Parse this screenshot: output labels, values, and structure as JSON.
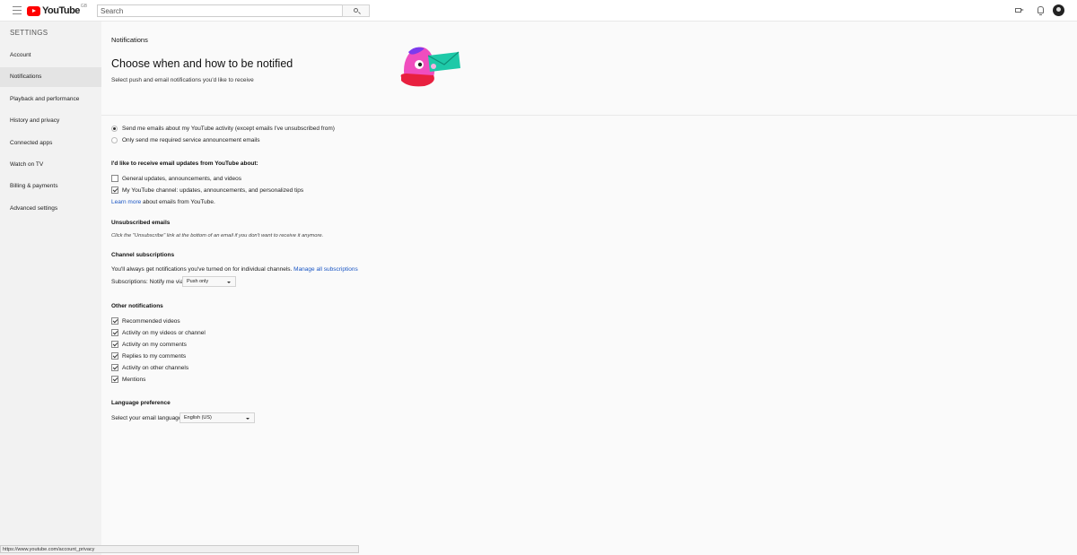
{
  "topbar": {
    "logo_text": "YouTube",
    "logo_region": "GB",
    "search_placeholder": "Search"
  },
  "sidebar": {
    "title": "SETTINGS",
    "items": [
      {
        "label": "Account"
      },
      {
        "label": "Notifications"
      },
      {
        "label": "Playback and performance"
      },
      {
        "label": "History and privacy"
      },
      {
        "label": "Connected apps"
      },
      {
        "label": "Watch on TV"
      },
      {
        "label": "Billing & payments"
      },
      {
        "label": "Advanced settings"
      }
    ]
  },
  "header": {
    "page_title": "Notifications",
    "headline": "Choose when and how to be notified",
    "subline": "Select push and email notifications you'd like to receive"
  },
  "email_mode": {
    "options": [
      {
        "label": "Send me emails about my YouTube activity (except emails I've unsubscribed from)",
        "selected": true
      },
      {
        "label": "Only send me required service announcement emails",
        "selected": false
      }
    ]
  },
  "email_updates": {
    "heading": "I'd like to receive email updates from YouTube about:",
    "options": [
      {
        "label": "General updates, announcements, and videos",
        "checked": false
      },
      {
        "label": "My YouTube channel: updates, announcements, and personalized tips",
        "checked": true
      }
    ],
    "learn_more_link": "Learn more",
    "learn_more_rest": " about emails from YouTube."
  },
  "unsubscribed": {
    "heading": "Unsubscribed emails",
    "note": "Click the \"Unsubscribe\" link at the bottom of an email if you don't want to receive it anymore."
  },
  "channel_subs": {
    "heading": "Channel subscriptions",
    "text": "You'll always get notifications you've turned on for individual channels.",
    "manage_link": "Manage all subscriptions",
    "notify_label": "Subscriptions: Notify me via",
    "notify_value": "Push only"
  },
  "other": {
    "heading": "Other notifications",
    "options": [
      {
        "label": "Recommended videos",
        "checked": true
      },
      {
        "label": "Activity on my videos or channel",
        "checked": true
      },
      {
        "label": "Activity on my comments",
        "checked": true
      },
      {
        "label": "Replies to my comments",
        "checked": true
      },
      {
        "label": "Activity on other channels",
        "checked": true
      },
      {
        "label": "Mentions",
        "checked": true
      }
    ]
  },
  "language": {
    "heading": "Language preference",
    "label": "Select your email language",
    "value": "English (US)"
  },
  "statusbar": {
    "url": "https://www.youtube.com/account_privacy"
  }
}
